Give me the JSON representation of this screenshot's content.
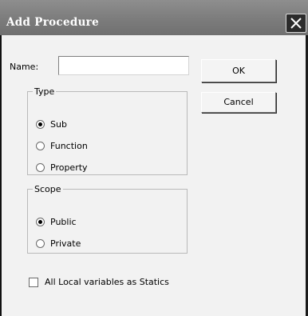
{
  "dialog": {
    "title": "Add Procedure",
    "close_icon": "close-icon"
  },
  "name_field": {
    "label": "Name:",
    "value": "",
    "placeholder": ""
  },
  "buttons": {
    "ok_label": "OK",
    "cancel_label": "Cancel"
  },
  "type_group": {
    "legend": "Type",
    "options": [
      {
        "label": "Sub",
        "checked": true
      },
      {
        "label": "Function",
        "checked": false
      },
      {
        "label": "Property",
        "checked": false
      }
    ]
  },
  "scope_group": {
    "legend": "Scope",
    "options": [
      {
        "label": "Public",
        "checked": true
      },
      {
        "label": "Private",
        "checked": false
      }
    ]
  },
  "statics_checkbox": {
    "label": "All Local variables as Statics",
    "checked": false
  },
  "colors": {
    "titlebar": "#7c7c7c",
    "title_text": "#ffffff",
    "close_button": "#2b2b2b",
    "client_background": "#f2f2f2"
  }
}
